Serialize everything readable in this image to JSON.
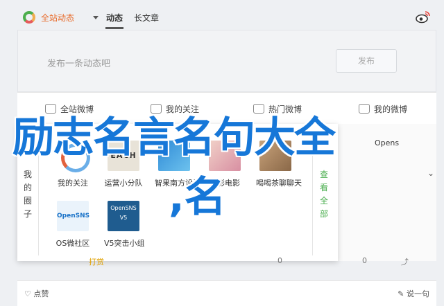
{
  "topbar": {
    "brand_label": "全站动态",
    "tabs": [
      "动态",
      "长文章"
    ]
  },
  "composer": {
    "placeholder": "发布一条动态吧",
    "publish_label": "发布"
  },
  "filters": [
    "全站微博",
    "我的关注",
    "热门微博",
    "我的微博"
  ],
  "panel": {
    "left_title": "我的圈子",
    "right_title": "查看全部",
    "tiles": [
      {
        "label": "我的关注",
        "image_text": ""
      },
      {
        "label": "运营小分队",
        "image_text": "EACH"
      },
      {
        "label": "智果南方设计",
        "image_text": ""
      },
      {
        "label": "电影电影",
        "image_text": ""
      },
      {
        "label": "喝喝茶聊聊天",
        "image_text": ""
      },
      {
        "label": "OS微社区",
        "image_text": "OpenSNS"
      },
      {
        "label": "V5突击小组",
        "image_text": "OpenSNS V5"
      }
    ]
  },
  "background": {
    "right_label": "Opens",
    "chevron": "⌄"
  },
  "footer": {
    "items": [
      "打赏",
      "0",
      "0",
      "0"
    ],
    "like_label": "点赞",
    "comment_label": "说一句"
  },
  "headline": {
    "line1": "励志名言名句大全",
    "line2": ",名"
  },
  "colors": {
    "accent": "#1677d8",
    "brand_orange": "#e86c2c",
    "green": "#4caf50"
  }
}
